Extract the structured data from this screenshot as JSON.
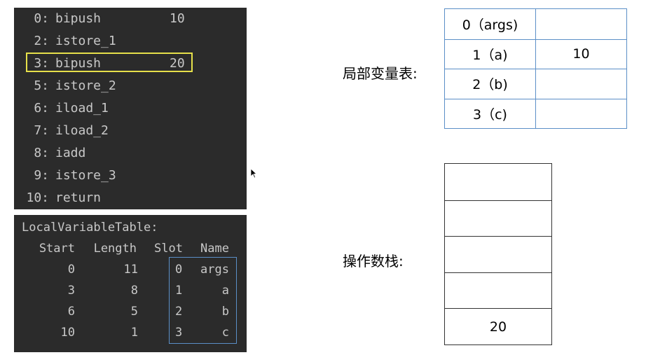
{
  "bytecode": {
    "lines": [
      {
        "idx": "0:",
        "op": "bipush",
        "arg": "10"
      },
      {
        "idx": "2:",
        "op": "istore_1",
        "arg": ""
      },
      {
        "idx": "3:",
        "op": "bipush",
        "arg": "20"
      },
      {
        "idx": "5:",
        "op": "istore_2",
        "arg": ""
      },
      {
        "idx": "6:",
        "op": "iload_1",
        "arg": ""
      },
      {
        "idx": "7:",
        "op": "iload_2",
        "arg": ""
      },
      {
        "idx": "8:",
        "op": "iadd",
        "arg": ""
      },
      {
        "idx": "9:",
        "op": "istore_3",
        "arg": ""
      },
      {
        "idx": "10:",
        "op": "return",
        "arg": ""
      }
    ],
    "highlight_color": "#e6e04a"
  },
  "local_variable_table": {
    "title": "LocalVariableTable:",
    "headers": [
      "Start",
      "Length",
      "Slot",
      "Name"
    ],
    "rows": [
      [
        "0",
        "11",
        "0",
        "args"
      ],
      [
        "3",
        "8",
        "1",
        "a"
      ],
      [
        "6",
        "5",
        "2",
        "b"
      ],
      [
        "10",
        "1",
        "3",
        "c"
      ]
    ],
    "box_color": "#5b8fc7"
  },
  "local_vars": {
    "label": "局部变量表:",
    "rows": [
      {
        "slot": "0（args)",
        "value": ""
      },
      {
        "slot": "1（a)",
        "value": "10"
      },
      {
        "slot": "2（b)",
        "value": ""
      },
      {
        "slot": "3（c)",
        "value": ""
      }
    ]
  },
  "operand_stack": {
    "label": "操作数栈:",
    "cells": [
      "",
      "",
      "",
      "",
      "20"
    ]
  }
}
